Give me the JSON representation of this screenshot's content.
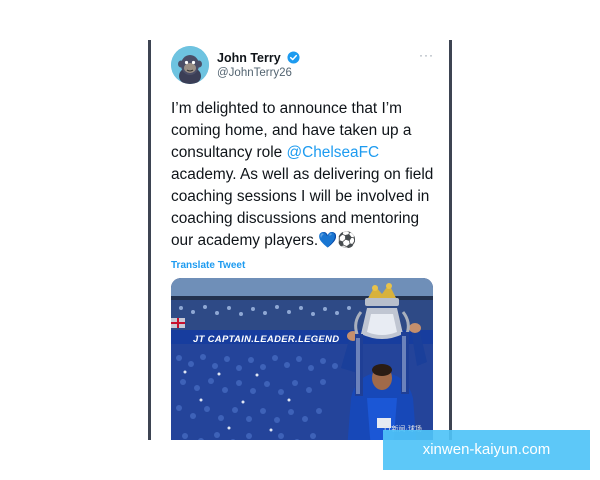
{
  "tweet": {
    "display_name": "John Terry",
    "handle": "@JohnTerry26",
    "text_before_mention": "I’m delighted to announce that I’m coming home, and have taken up a consultancy role ",
    "mention": "@ChelseaFC",
    "text_after_mention": " academy. As well as delivering on field coaching sessions I will be involved in coaching discussions and mentoring our academy players.💙⚽",
    "translate_label": "Translate Tweet",
    "more_label": "···",
    "verified_icon": "verified-badge-icon",
    "colors": {
      "link": "#1d9bf0",
      "text": "#0f1419",
      "secondary": "#536471"
    }
  },
  "media": {
    "banner_text": "JT CAPTAIN.LEADER.LEGEND",
    "photo_watermark": "TT新闻·球场"
  },
  "watermark": {
    "text": "xinwen-kaiyun.com",
    "color": "#4fc3f7"
  }
}
